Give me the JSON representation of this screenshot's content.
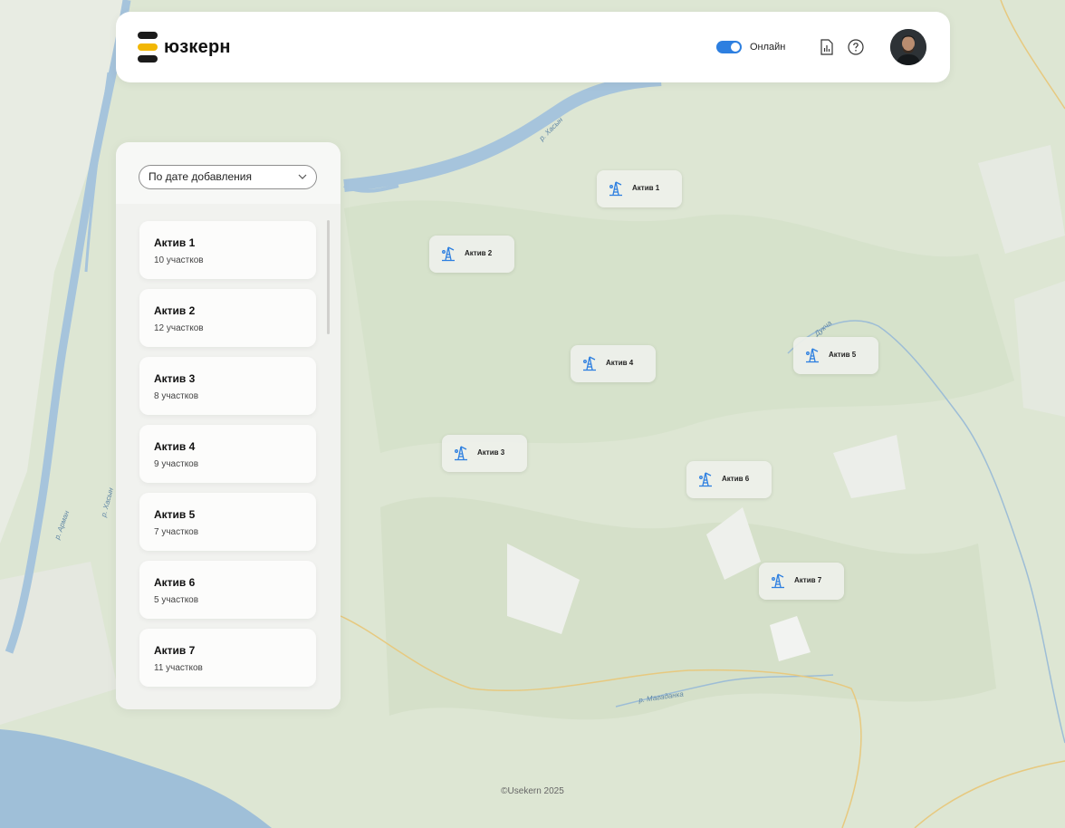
{
  "header": {
    "brand": "юзкерн",
    "online_label": "Онлайн",
    "online_enabled": true,
    "icons": [
      "report-icon",
      "help-icon"
    ],
    "avatar": "user-avatar"
  },
  "sidebar": {
    "sort_value": "По дате добавления",
    "assets": [
      {
        "name": "Актив 1",
        "count": "10 участков"
      },
      {
        "name": "Актив 2",
        "count": "12 участков"
      },
      {
        "name": "Актив 3",
        "count": "8 участков"
      },
      {
        "name": "Актив 4",
        "count": "9 участков"
      },
      {
        "name": "Актив 5",
        "count": "7 участков"
      },
      {
        "name": "Актив 6",
        "count": "5 участков"
      },
      {
        "name": "Актив 7",
        "count": "11 участков"
      }
    ]
  },
  "map": {
    "markers": [
      "Актив 1",
      "Актив 2",
      "Актив 3",
      "Актив 4",
      "Актив 5",
      "Актив 6",
      "Актив 7"
    ],
    "river_labels": [
      "р. Хасын",
      "р. Хасын",
      "р. Арман",
      "р. Магаданка",
      "Дукча"
    ]
  },
  "footer": {
    "copyright": "©Usekern 2025"
  },
  "colors": {
    "accent": "#2d7fe0",
    "logo_black": "#1b1b1b",
    "logo_yellow": "#f2b705",
    "map_base": "#dfe7d6",
    "water": "#9fbfd8"
  }
}
